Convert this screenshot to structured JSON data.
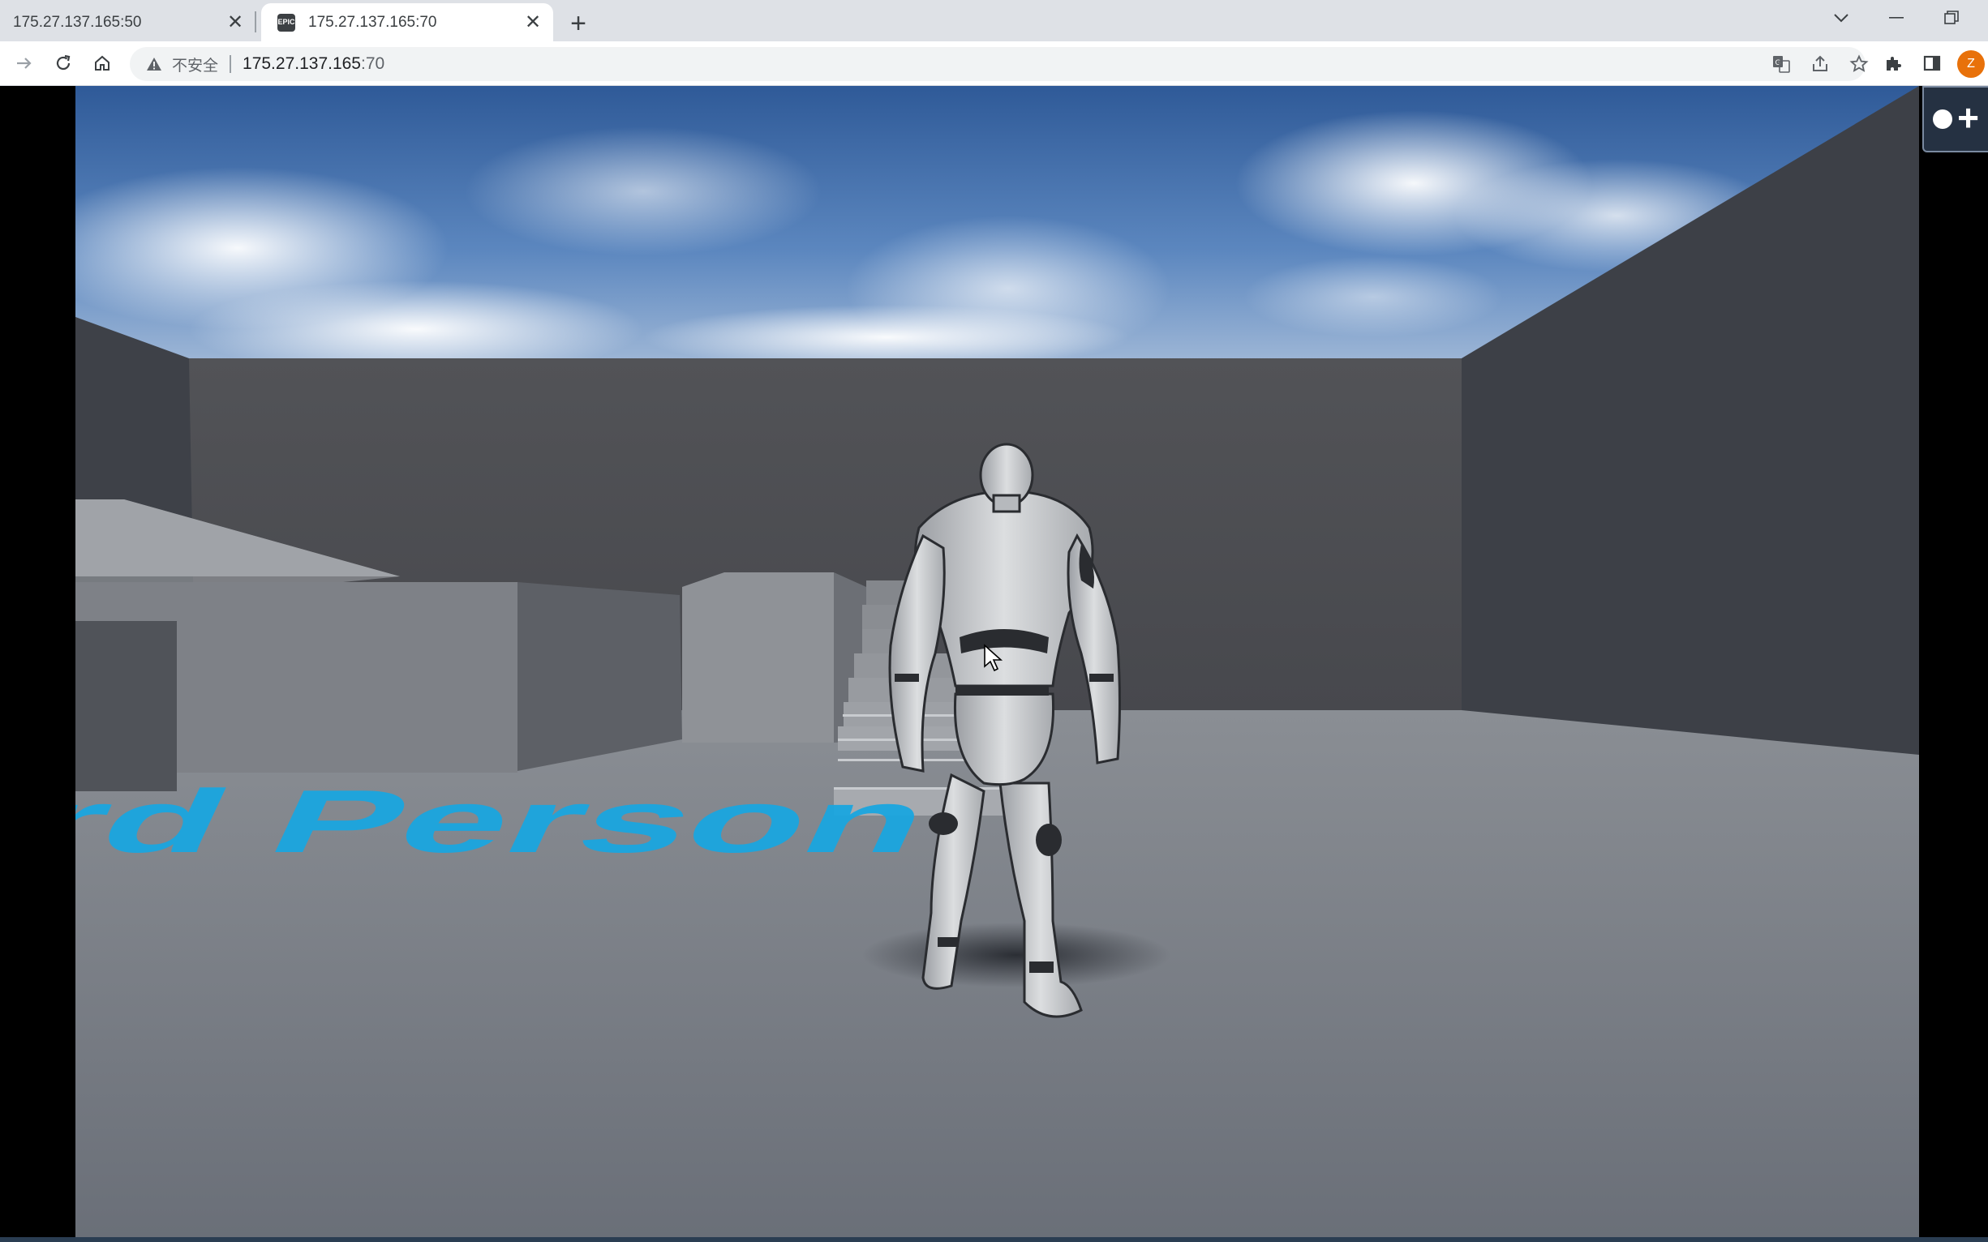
{
  "browser": {
    "tabs": [
      {
        "title": "175.27.137.165:50",
        "active": false,
        "close_icon": "close-icon"
      },
      {
        "title": "175.27.137.165:70",
        "active": true,
        "favicon": "epic-games-logo",
        "close_icon": "close-icon"
      }
    ],
    "new_tab_icon": "plus-icon",
    "window_controls": [
      "chevron-down-icon",
      "minimize-icon",
      "restore-icon"
    ],
    "nav_icons": [
      "forward-icon",
      "reload-icon",
      "home-icon"
    ],
    "address_bar": {
      "security_icon": "warning-triangle-icon",
      "security_label": "不安全",
      "url_host": "175.27.137.165",
      "url_port": ":70"
    },
    "omnibox_icons": [
      "translate-icon",
      "share-icon",
      "star-icon"
    ],
    "toolbar_icons": [
      "extensions-puzzle-icon",
      "side-panel-icon"
    ],
    "profile_initial": "Z",
    "profile_color": "#e8710a"
  },
  "game": {
    "floor_text": "rd Person",
    "floor_text_color": "#1aa6e0",
    "overlay_button": {
      "icons": [
        "circle-icon",
        "plus-icon"
      ]
    },
    "cursor_icon": "mouse-pointer-icon"
  }
}
